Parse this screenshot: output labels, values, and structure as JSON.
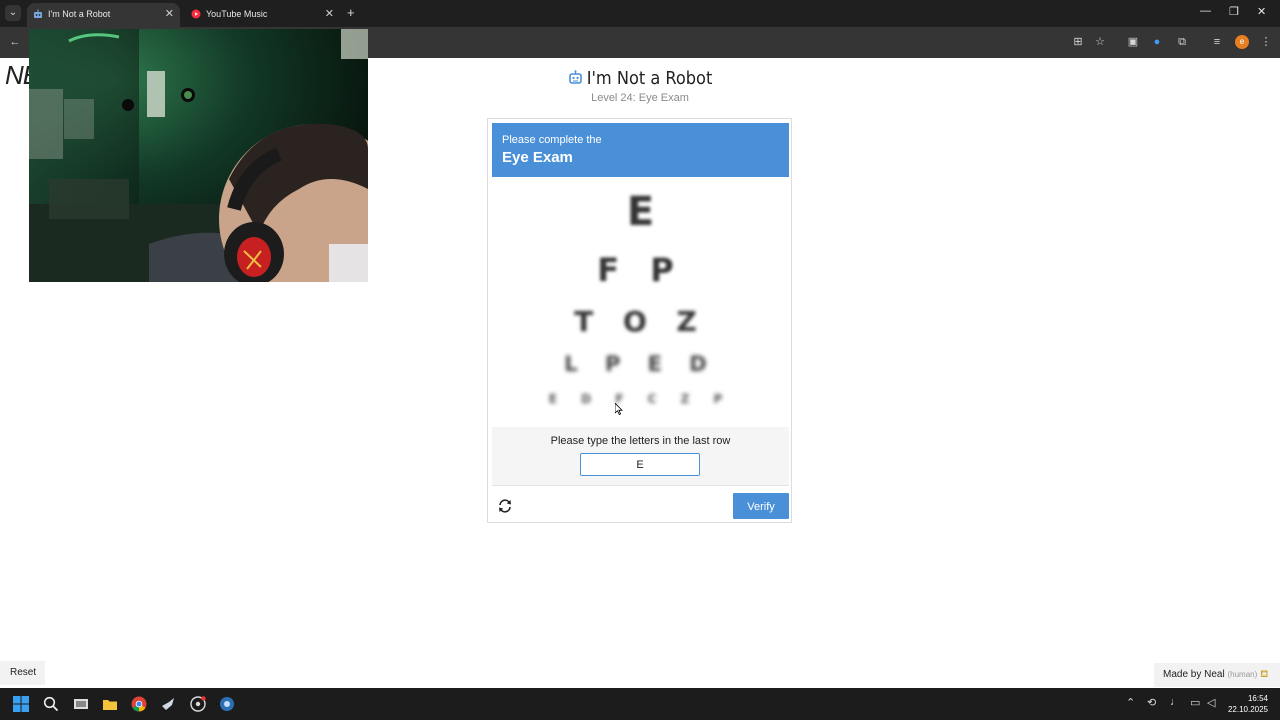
{
  "browser": {
    "tabs": [
      {
        "title": "I'm Not a Robot",
        "active": true
      },
      {
        "title": "YouTube Music",
        "active": false
      }
    ],
    "new_tab": "+",
    "window_controls": [
      "—",
      "❐",
      "✕"
    ]
  },
  "left_clip_text": "NE",
  "page": {
    "title": "I'm Not a Robot",
    "subtitle": "Level 24: Eye Exam"
  },
  "challenge": {
    "instruction": "Please complete the",
    "name": "Eye Exam",
    "eye_chart_rows": [
      "E",
      "F P",
      "T O Z",
      "L P E D",
      "E D F C Z P"
    ],
    "prompt": "Please type the letters in the last row",
    "answer_value": "E",
    "verify_label": "Verify"
  },
  "footer": {
    "reset_label": "Reset",
    "made_by": "Made by Neal",
    "made_by_note": "(human)"
  },
  "taskbar": {
    "time": "16:54",
    "date": "22.10.2025"
  },
  "colors": {
    "accent": "#4a90d9",
    "browser_dark": "#1f1f1f",
    "toolbar": "#353535"
  }
}
